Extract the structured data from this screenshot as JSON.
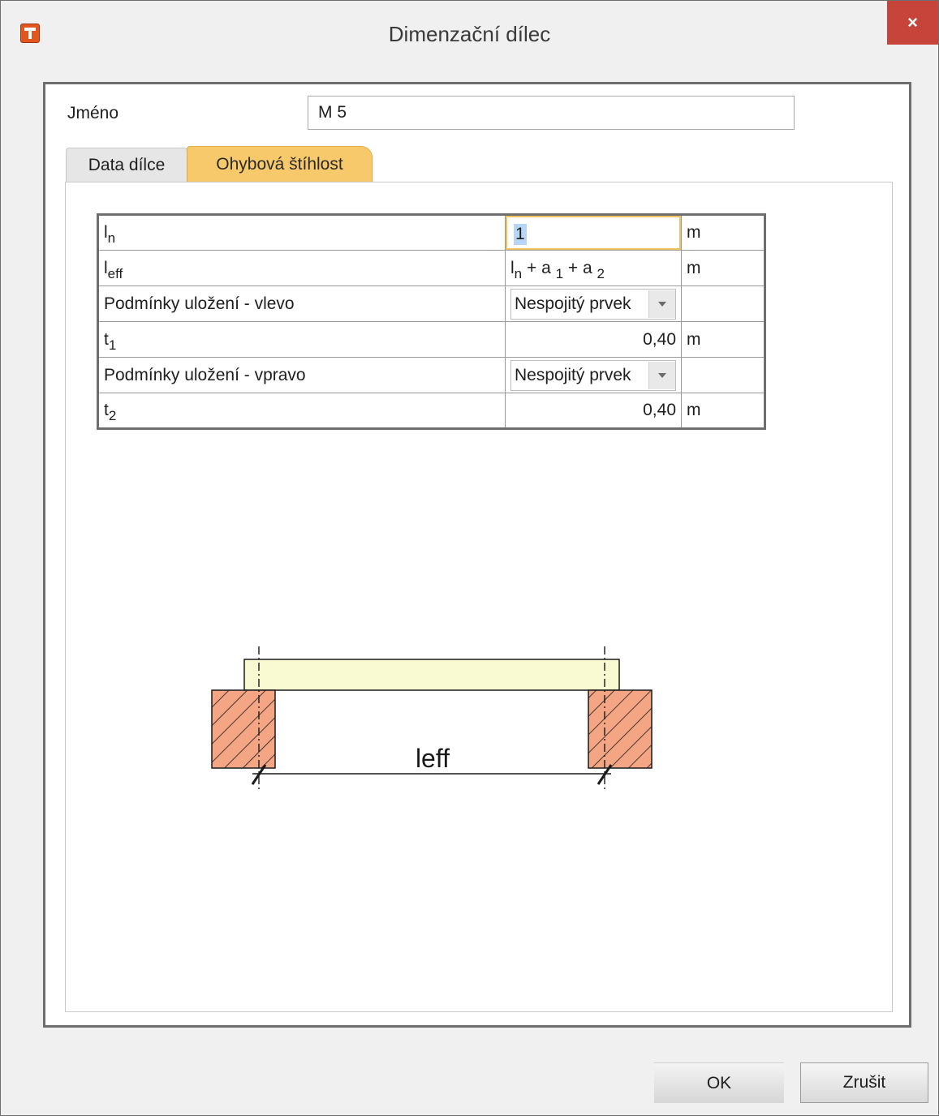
{
  "window": {
    "title": "Dimenzační dílec",
    "close_label": "×"
  },
  "form": {
    "name_label": "Jméno",
    "name_value": "M 5"
  },
  "tabs": [
    {
      "label": "Data dílce",
      "active": false
    },
    {
      "label": "Ohybová štíhlost",
      "active": true
    }
  ],
  "properties": {
    "rows": [
      {
        "name": "l",
        "name_sub": "n",
        "value": "1",
        "unit": "m"
      },
      {
        "name": "l",
        "name_sub": "eff",
        "value_parts": [
          "l",
          "n",
          " + a ",
          "1",
          " + a ",
          "2"
        ],
        "unit": "m"
      },
      {
        "name": "Podmínky uložení - vlevo",
        "value": "Nespojitý prvek",
        "unit": ""
      },
      {
        "name": "t",
        "name_sub": "1",
        "value": "0,40",
        "unit": "m"
      },
      {
        "name": "Podmínky uložení - vpravo",
        "value": "Nespojitý prvek",
        "unit": ""
      },
      {
        "name": "t",
        "name_sub": "2",
        "value": "0,40",
        "unit": "m"
      }
    ]
  },
  "diagram": {
    "label": "leff",
    "colors": {
      "beam_fill": "#fafad2",
      "support_fill": "#f4a583",
      "line": "#1a1a1a"
    }
  },
  "buttons": {
    "ok_label": "OK",
    "cancel_label": "Zrušit"
  }
}
